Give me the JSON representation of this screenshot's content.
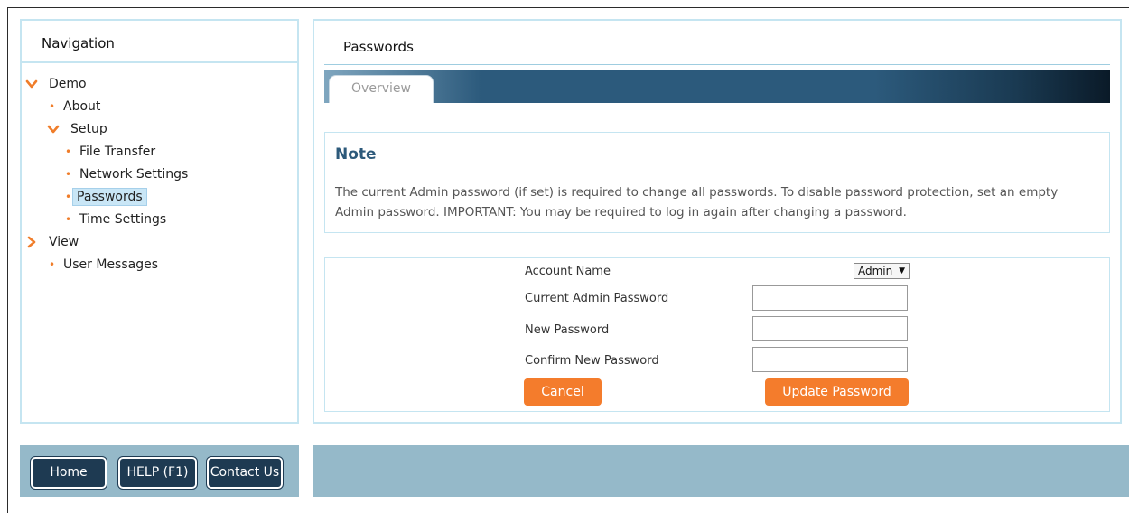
{
  "navigation": {
    "title": "Navigation",
    "items": [
      {
        "label": "Demo",
        "type": "expanded"
      },
      {
        "label": "About",
        "type": "leaf"
      },
      {
        "label": "Setup",
        "type": "expanded"
      },
      {
        "label": "File Transfer",
        "type": "leaf"
      },
      {
        "label": "Network Settings",
        "type": "leaf"
      },
      {
        "label": "Passwords",
        "type": "leaf",
        "selected": true
      },
      {
        "label": "Time Settings",
        "type": "leaf"
      },
      {
        "label": "View",
        "type": "collapsed"
      },
      {
        "label": "User Messages",
        "type": "leaf"
      }
    ]
  },
  "main": {
    "title": "Passwords",
    "tabs": [
      {
        "label": "Overview",
        "active": true
      }
    ],
    "note": {
      "title": "Note",
      "text": "The current Admin password (if set) is required to change all passwords. To disable password protection, set an empty Admin password. IMPORTANT: You may be required to log in again after changing a password."
    },
    "form": {
      "account_name_label": "Account Name",
      "account_name_value": "Admin",
      "current_password_label": "Current Admin Password",
      "new_password_label": "New Password",
      "confirm_password_label": "Confirm New Password",
      "cancel_label": "Cancel",
      "update_label": "Update Password"
    }
  },
  "footer": {
    "home_label": "Home",
    "help_label": "HELP (F1)",
    "contact_label": "Contact Us"
  },
  "colors": {
    "accent": "#f47c2c",
    "panel_border": "#c5e5f1",
    "tab_bar": "#2c5a7c",
    "footer_bg": "#95b9c9",
    "footer_button": "#1e3a52"
  }
}
